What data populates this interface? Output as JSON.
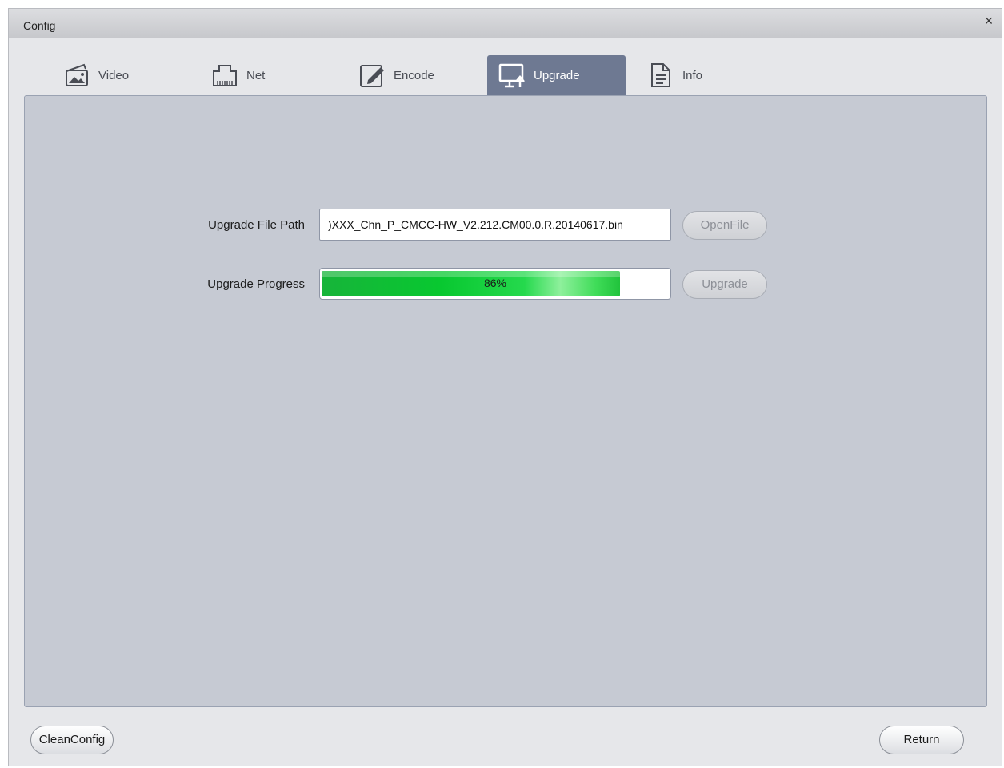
{
  "window": {
    "title": "Config",
    "close_symbol": "×"
  },
  "tabs": [
    {
      "label": "Video",
      "icon": "video-image-icon",
      "active": false
    },
    {
      "label": "Net",
      "icon": "network-port-icon",
      "active": false
    },
    {
      "label": "Encode",
      "icon": "encode-edit-icon",
      "active": false
    },
    {
      "label": "Upgrade",
      "icon": "monitor-upload-icon",
      "active": true
    },
    {
      "label": "Info",
      "icon": "document-icon",
      "active": false
    }
  ],
  "upgrade": {
    "file_path_label": "Upgrade File Path",
    "file_path_value": ")XXX_Chn_P_CMCC-HW_V2.212.CM00.0.R.20140617.bin",
    "open_file_button": "OpenFile",
    "progress_label": "Upgrade Progress",
    "progress_text": "86%",
    "progress_value": 0.86,
    "upgrade_button": "Upgrade"
  },
  "footer": {
    "clean_config_button": "CleanConfig",
    "return_button": "Return"
  },
  "colors": {
    "active_tab": "#6e7992",
    "panel": "#c6cad3",
    "progress": "#08c830"
  }
}
